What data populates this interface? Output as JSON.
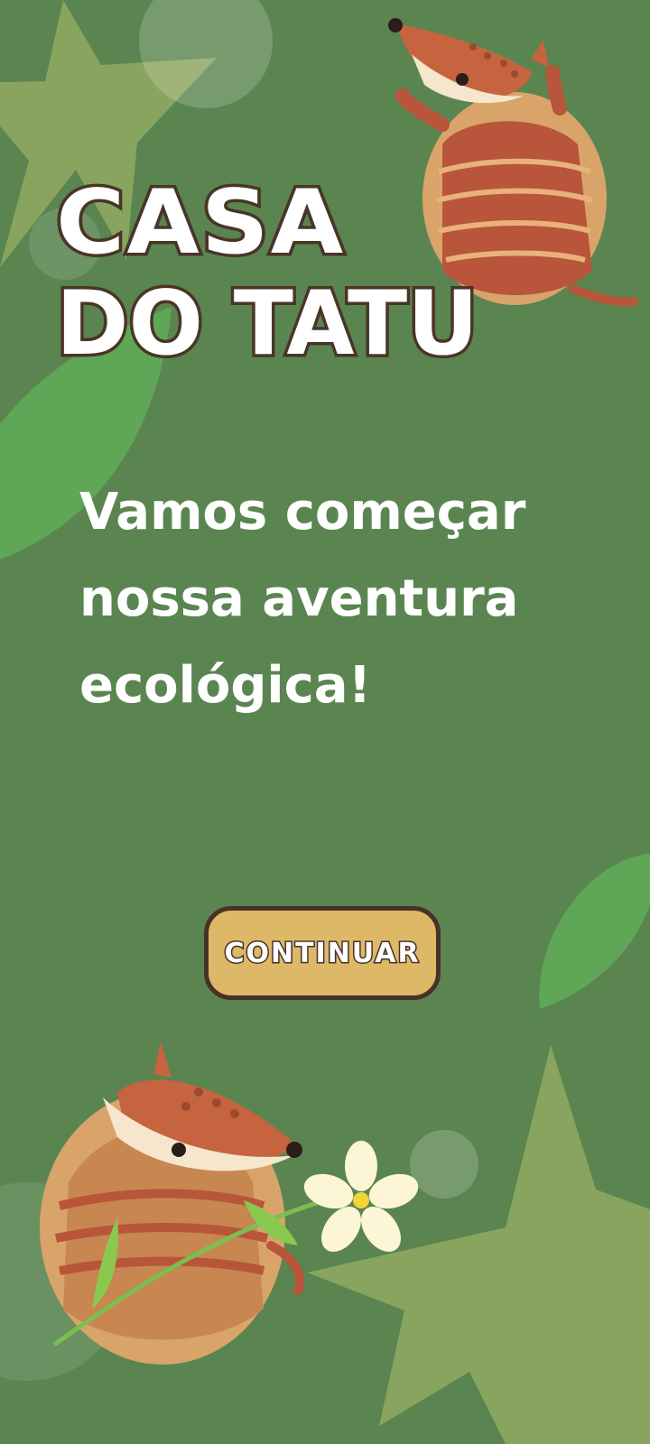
{
  "title": {
    "line1": "CASA",
    "line2": "DO TATU"
  },
  "subtitle": "Vamos começar nossa aventura ecológica!",
  "button": {
    "label": "CONTINUAR"
  },
  "colors": {
    "background": "#5a8550",
    "leaf": "#5fa756",
    "star": "#8ca55f",
    "button": "#ddb866",
    "outline": "#473128",
    "text": "#ffffff"
  },
  "illustrations": {
    "top_character": "armadillo-waving-illustration",
    "bottom_character": "armadillo-with-flower-illustration",
    "decorations": [
      "star-icon",
      "leaf-icon",
      "bubble-icon",
      "flower-icon"
    ]
  }
}
